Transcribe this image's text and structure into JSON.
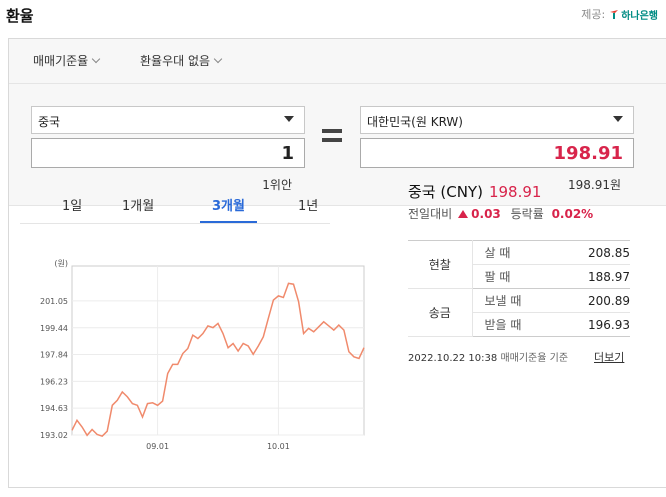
{
  "header": {
    "title": "환율",
    "provider_label": "제공:",
    "provider_name": "하나은행"
  },
  "filters": {
    "rate_basis": "매매기준율",
    "preferential": "환율우대 없음"
  },
  "converter": {
    "from_currency": "중국",
    "to_currency": "대한민국(원 KRW)",
    "from_amount": "1",
    "to_amount": "198.91",
    "from_caption": "1위안",
    "to_caption": "198.91원"
  },
  "tabs": [
    {
      "label": "1일",
      "active": false
    },
    {
      "label": "1개월",
      "active": false
    },
    {
      "label": "3개월",
      "active": true
    },
    {
      "label": "1년",
      "active": false
    }
  ],
  "info": {
    "currency": "중국 (CNY)",
    "rate": "198.91",
    "change_label": "전일대비",
    "change_value": "0.03",
    "pct_label": "등락률",
    "pct_value": "0.02%"
  },
  "rates_table": {
    "groups": [
      {
        "name": "현찰",
        "rows": [
          {
            "label": "살 때",
            "value": "208.85"
          },
          {
            "label": "팔 때",
            "value": "188.97"
          }
        ]
      },
      {
        "name": "송금",
        "rows": [
          {
            "label": "보낼 때",
            "value": "200.89"
          },
          {
            "label": "받을 때",
            "value": "196.93"
          }
        ]
      }
    ]
  },
  "footer": {
    "timestamp": "2022.10.22 10:38",
    "basis_note": "매매기준율 기준",
    "more_label": "더보기"
  },
  "colors": {
    "accent_blue": "#2a6ad8",
    "up_red": "#d8244b",
    "line": "#f08a6c"
  },
  "chart_data": {
    "type": "line",
    "unit_label": "(원)",
    "yticks": [
      "201.05",
      "199.44",
      "197.84",
      "196.23",
      "194.63",
      "193.02"
    ],
    "ylim": [
      193.02,
      202.66
    ],
    "xticks": [
      {
        "label": "09.01",
        "index": 17
      },
      {
        "label": "10.01",
        "index": 41
      }
    ],
    "grid": true,
    "values": [
      193.3,
      193.9,
      193.5,
      193.0,
      193.35,
      193.05,
      192.95,
      193.25,
      194.8,
      195.1,
      195.6,
      195.3,
      194.9,
      194.8,
      194.1,
      194.9,
      194.95,
      194.8,
      195.05,
      196.7,
      197.25,
      197.25,
      197.9,
      198.2,
      199.0,
      198.8,
      199.1,
      199.55,
      199.45,
      199.7,
      199.1,
      198.25,
      198.5,
      198.05,
      198.5,
      198.35,
      197.85,
      198.35,
      198.9,
      200.0,
      201.1,
      201.35,
      201.25,
      202.1,
      202.05,
      201.0,
      199.1,
      199.4,
      199.2,
      199.5,
      199.8,
      199.55,
      199.3,
      199.6,
      199.3,
      198.0,
      197.7,
      197.6,
      198.25
    ]
  }
}
